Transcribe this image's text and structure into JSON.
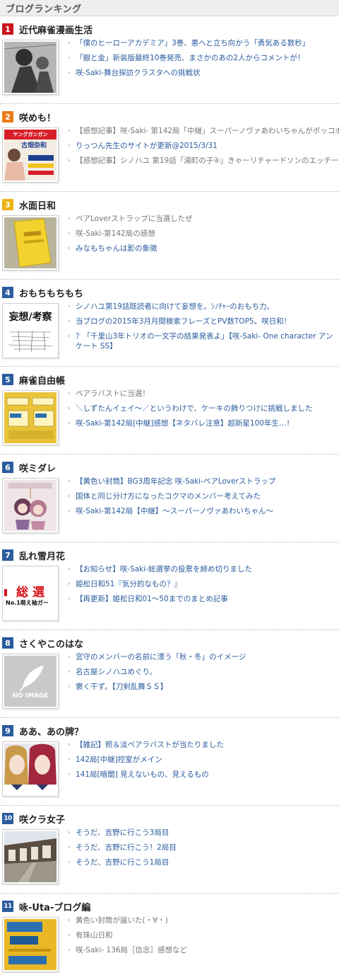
{
  "header": {
    "title": "ブログランキング"
  },
  "blogs": [
    {
      "rank": "1",
      "name": "近代麻雀漫画生活",
      "thumb_icon": "manga-panel-image",
      "articles": [
        "「僕のヒーローアカデミア」3巻、悪へと立ち向かう「勇気ある数秒」",
        "「銀と金」新装版最終10巻発売、まさかのあの2人からコメントが！",
        "咲-Saki-舞台探訪クラスタへの挑戦状"
      ]
    },
    {
      "rank": "2",
      "name": "咲めも！",
      "thumb_icon": "magazine-cover-image",
      "thumb_text": [
        "ヤングガンガン",
        "古畑奈和"
      ],
      "articles": [
        "【感想記事】咲-Saki- 第142局「中継」スーパーノヴァあわいちゃんがボッコボコにしてやんよ！",
        "りっつん先生のサイトが更新@2015/3/31",
        "【感想記事】シノハユ 第19話「湯町の子④」きゃーリチャードソンのエッチー"
      ]
    },
    {
      "rank": "3",
      "name": "水面日和",
      "thumb_icon": "yellow-envelope-image",
      "articles": [
        "ペアLoverストラップに当選したぜ",
        "咲-Saki-第142局の感想",
        "みなもちゃんは影の象徴"
      ]
    },
    {
      "rank": "4",
      "name": "おもちもちもち",
      "thumb_icon": "calligraphy-image",
      "thumb_text": [
        "妄想",
        "考察"
      ],
      "articles": [
        "シノハユ第19話既読者に向けて妄想を。ｼﾉﾁｬｰのおもち力。",
        "当ブログの2015年3月月間検索フレーズとPV数TOP5。咲日和！",
        "？「千里山3年トリオの一文字の結果発表よ」【咲-Saki- One character アンケート SS】"
      ]
    },
    {
      "rank": "5",
      "name": "麻雀自由帳",
      "thumb_icon": "yellow-envelope-image",
      "articles": [
        "ペアラバストに当選！",
        "＼しずたんイェイ～／というわけで、ケーキの飾りつけに挑戦しました",
        "咲-Saki-第142局[中継]感想【ネタバレ注意】超新星100年生…！"
      ]
    },
    {
      "rank": "6",
      "name": "咲ミダレ",
      "thumb_icon": "strap-photo-image",
      "articles": [
        "【黄色い封筒】BG3周年記念 咲-Saki-ペアLoverストラップ",
        "国体と同じ分け方になったコクマのメンバー考えてみた",
        "咲-Saki-第142局【中継】～スーパーノヴァあわいちゃん～"
      ]
    },
    {
      "rank": "7",
      "name": "乱れ雪月花",
      "thumb_icon": "election-banner-image",
      "thumb_text": [
        "総 選",
        "No.1萌え袖ガー"
      ],
      "articles": [
        "【お知らせ】咲-Saki-総選挙の投票を締め切りました",
        "姫松日和51『気分的なもの？』",
        "【再更新】姫松日和01～50までのまとめ記事"
      ]
    },
    {
      "rank": "8",
      "name": "さくやこのはな",
      "thumb_icon": "no-image-placeholder",
      "thumb_text": [
        "NO IMAGE"
      ],
      "articles": [
        "宮守のメンバーの名前に漂う「秋・冬」のイメージ",
        "名古屋シノハユめぐり。",
        "褒く干ず。【刀剣乱舞ＳＳ】"
      ]
    },
    {
      "rank": "9",
      "name": "ああ、あの牌？",
      "thumb_icon": "anime-girls-image",
      "articles": [
        "【雑記】照＆淡ペアラバストが当たりました",
        "142局[中継]控室がメイン",
        "141局[暗闇] 見えないもの、見えるもの"
      ]
    },
    {
      "rank": "10",
      "name": "咲クラ女子",
      "thumb_icon": "street-photo-image",
      "articles": [
        "そうだ、吉野に行こう3局目",
        "そうだ、吉野に行こう！2局目",
        "そうだ、吉野に行こう1局目"
      ]
    },
    {
      "rank": "11",
      "name": "咏-Uta-ブログ編",
      "thumb_icon": "yellow-envelope-image",
      "articles": [
        "黄色い封筒が届いた(・∀・)",
        "有珠山日和",
        "咲-Saki- 136局［信念］感想など"
      ]
    }
  ]
}
